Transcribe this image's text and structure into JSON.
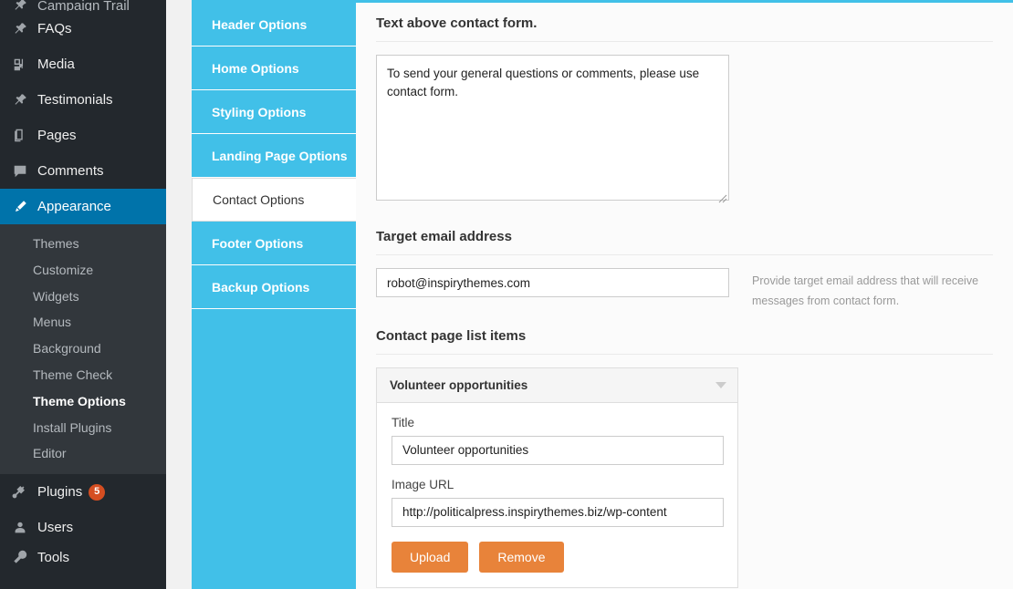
{
  "sidebar": {
    "top_items": [
      {
        "label": "Campaign Trail",
        "icon": "pin-icon",
        "cut": true
      },
      {
        "label": "FAQs",
        "icon": "pin-icon"
      },
      {
        "label": "Media",
        "icon": "media-icon"
      },
      {
        "label": "Testimonials",
        "icon": "pin-icon"
      },
      {
        "label": "Pages",
        "icon": "pages-icon"
      },
      {
        "label": "Comments",
        "icon": "comments-icon"
      }
    ],
    "current_item": {
      "label": "Appearance",
      "icon": "appearance-brush-icon"
    },
    "submenu": [
      {
        "label": "Themes",
        "current": false
      },
      {
        "label": "Customize",
        "current": false
      },
      {
        "label": "Widgets",
        "current": false
      },
      {
        "label": "Menus",
        "current": false
      },
      {
        "label": "Background",
        "current": false
      },
      {
        "label": "Theme Check",
        "current": false
      },
      {
        "label": "Theme Options",
        "current": true
      },
      {
        "label": "Install Plugins",
        "current": false
      },
      {
        "label": "Editor",
        "current": false
      }
    ],
    "bottom_items": [
      {
        "label": "Plugins",
        "icon": "plugins-icon",
        "badge": "5"
      },
      {
        "label": "Users",
        "icon": "users-icon",
        "badge": ""
      },
      {
        "label": "Tools",
        "icon": "tools-icon",
        "badge": "",
        "cut": true
      }
    ],
    "colors": {
      "background": "#23282d",
      "submenu_background": "#32373c",
      "current_highlight": "#0073aa",
      "badge": "#d54e21"
    }
  },
  "tabs": {
    "items": [
      {
        "label": "Header Options",
        "active": false
      },
      {
        "label": "Home Options",
        "active": false
      },
      {
        "label": "Styling Options",
        "active": false
      },
      {
        "label": "Landing Page Options",
        "active": false
      },
      {
        "label": "Contact Options",
        "active": true
      },
      {
        "label": "Footer Options",
        "active": false
      },
      {
        "label": "Backup Options",
        "active": false
      }
    ],
    "accent_color": "#41c0e8"
  },
  "content": {
    "text_above_form": {
      "heading": "Text above contact form.",
      "value": "To send your general questions or comments, please use contact form."
    },
    "target_email": {
      "heading": "Target email address",
      "value": "robot@inspirythemes.com",
      "description": "Provide target email address that will receive messages from contact form."
    },
    "list_items": {
      "heading": "Contact page list items",
      "item": {
        "header_title": "Volunteer opportunities",
        "caret_icon": "chevron-down-icon",
        "title_label": "Title",
        "title_value": "Volunteer opportunities",
        "image_url_label": "Image URL",
        "image_url_value": "http://politicalpress.inspirythemes.biz/wp-content",
        "upload_label": "Upload",
        "remove_label": "Remove",
        "button_color": "#e8833a"
      }
    }
  }
}
